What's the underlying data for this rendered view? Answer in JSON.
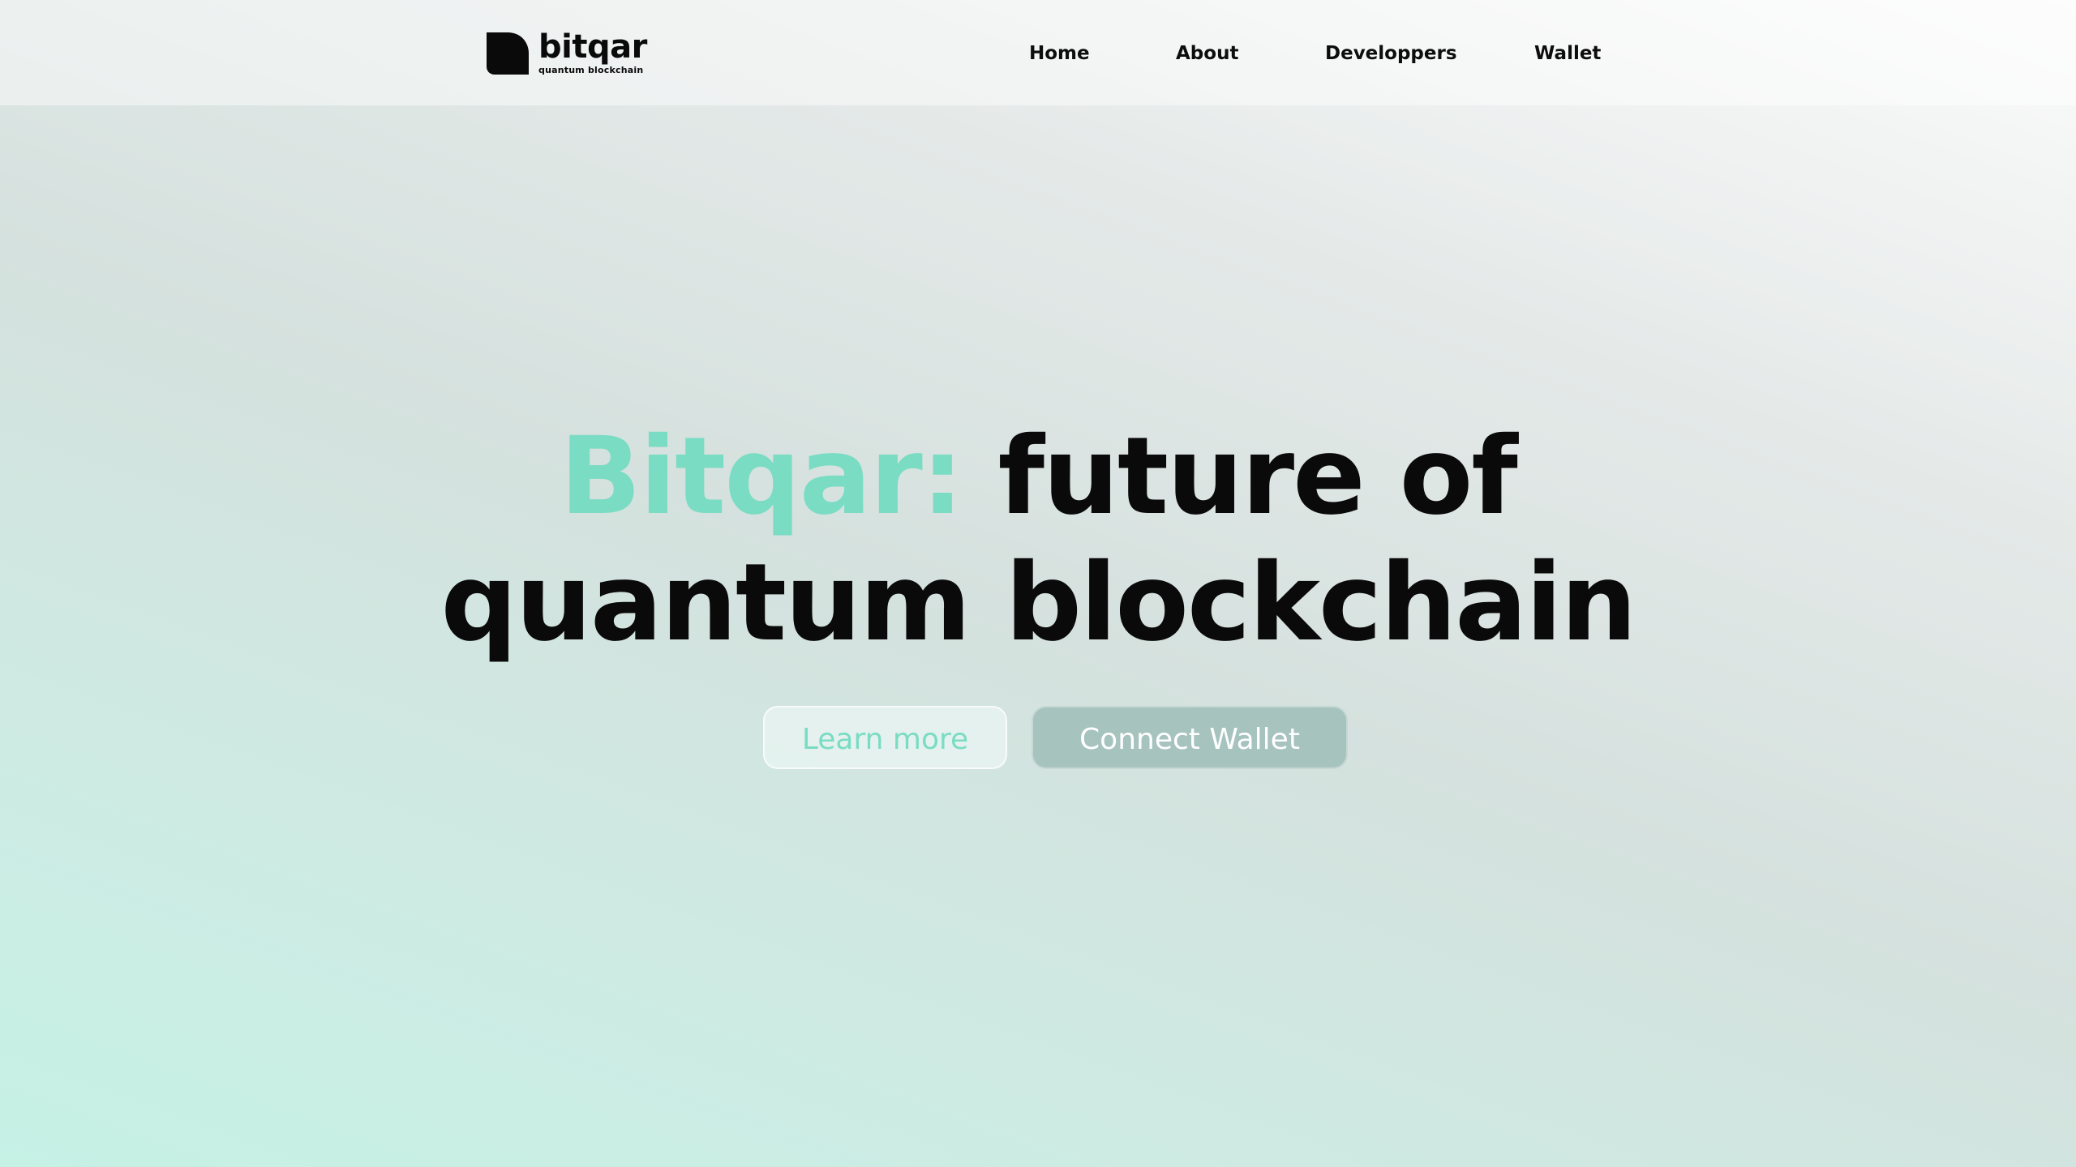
{
  "brand": {
    "name": "bitqar",
    "tagline": "quantum blockchain",
    "logo_icon": "bitqar-logo-mark"
  },
  "nav": {
    "items": [
      {
        "label": "Home"
      },
      {
        "label": "About"
      },
      {
        "label": "Developpers"
      },
      {
        "label": "Wallet"
      }
    ]
  },
  "hero": {
    "title_accent": "Bitqar:",
    "title_line1_rest": "future of",
    "title_line2": "quantum blockchain"
  },
  "buttons": {
    "learn_more": "Learn more",
    "connect_wallet": "Connect Wallet"
  },
  "colors": {
    "accent": "#7adcc3",
    "text": "#0a0a0a",
    "connect_bg": "#a6c3bd"
  }
}
